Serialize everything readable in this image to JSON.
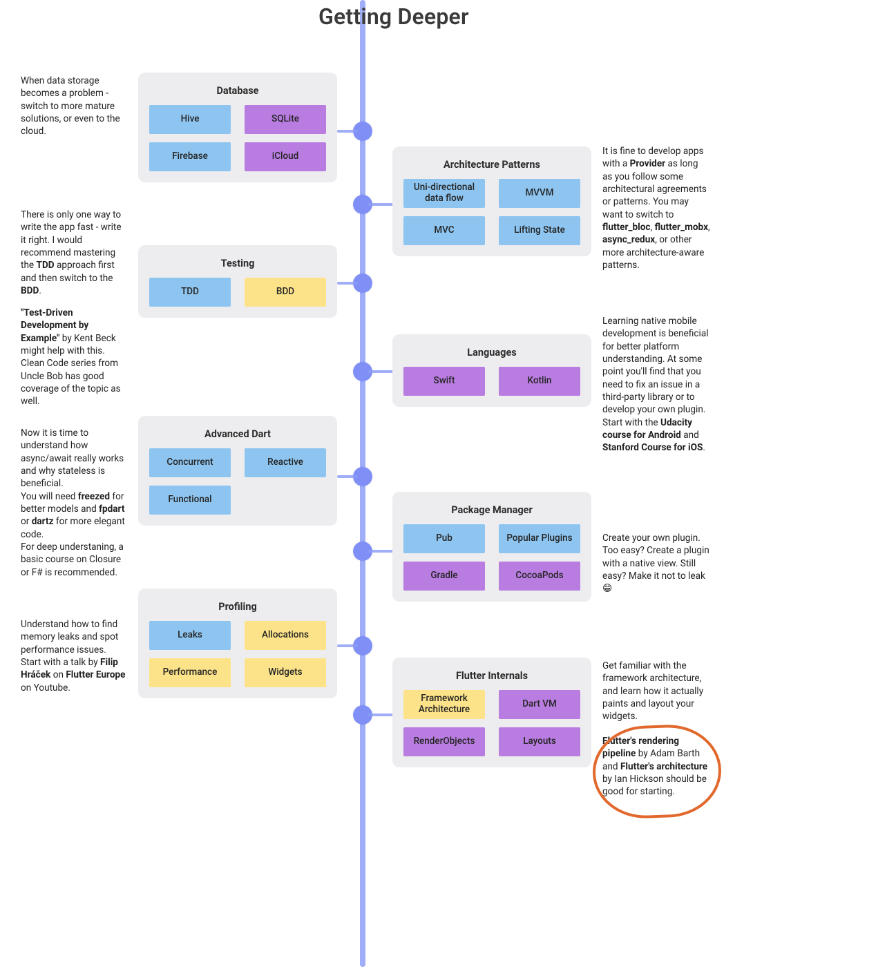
{
  "title": "Getting Deeper",
  "database": {
    "heading": "Database",
    "items": [
      {
        "label": "Hive",
        "c": "b"
      },
      {
        "label": "SQLite",
        "c": "p"
      },
      {
        "label": "Firebase",
        "c": "b"
      },
      {
        "label": "iCloud",
        "c": "p"
      }
    ]
  },
  "arch": {
    "heading": "Architecture Patterns",
    "items": [
      {
        "label": "Uni-directional data flow",
        "c": "b"
      },
      {
        "label": "MVVM",
        "c": "b"
      },
      {
        "label": "MVC",
        "c": "b"
      },
      {
        "label": "Lifting State",
        "c": "b"
      }
    ]
  },
  "testing": {
    "heading": "Testing",
    "items": [
      {
        "label": "TDD",
        "c": "b"
      },
      {
        "label": "BDD",
        "c": "y"
      }
    ]
  },
  "languages": {
    "heading": "Languages",
    "items": [
      {
        "label": "Swift",
        "c": "p"
      },
      {
        "label": "Kotlin",
        "c": "p"
      }
    ]
  },
  "advdart": {
    "heading": "Advanced Dart",
    "items": [
      {
        "label": "Concurrent",
        "c": "b"
      },
      {
        "label": "Reactive",
        "c": "b"
      },
      {
        "label": "Functional",
        "c": "b"
      }
    ]
  },
  "pkg": {
    "heading": "Package Manager",
    "items": [
      {
        "label": "Pub",
        "c": "b"
      },
      {
        "label": "Popular Plugins",
        "c": "b"
      },
      {
        "label": "Gradle",
        "c": "p"
      },
      {
        "label": "CocoaPods",
        "c": "p"
      }
    ]
  },
  "profiling": {
    "heading": "Profiling",
    "items": [
      {
        "label": "Leaks",
        "c": "b"
      },
      {
        "label": "Allocations",
        "c": "y"
      },
      {
        "label": "Performance",
        "c": "y"
      },
      {
        "label": "Widgets",
        "c": "y"
      }
    ]
  },
  "internals": {
    "heading": "Flutter Internals",
    "items": [
      {
        "label": "Framework Architecture",
        "c": "y"
      },
      {
        "label": "Dart VM",
        "c": "p"
      },
      {
        "label": "RenderObjects",
        "c": "p"
      },
      {
        "label": "Layouts",
        "c": "p"
      }
    ]
  },
  "notes": {
    "db": "When data storage becomes a problem - switch to more mature solutions, or even to the cloud.",
    "arch": "It is fine to develop apps with a <b>Provider</b> as long as you follow some architectural agreements or patterns. You may want to switch to <b>flutter_bloc</b>, <b>flutter_mobx</b>, <b>async_redux</b>, or other more architecture-aware patterns.",
    "testing1": "There is only one way to write the app fast - write it right. I would recommend mastering the <b>TDD</b> approach first and then switch to the <b>BDD</b>.",
    "testing2": "<b>\"Test-Driven Development by Example\"</b> by Kent Beck might help with this. Clean Code series from Uncle Bob has good coverage of the topic as well.",
    "lang": "Learning native mobile development is beneficial for better platform understanding. At some point you'll find that you need to fix an issue in a third-party library or to develop your own plugin. Start with the <b>Udacity course for Android</b> and <b>Stanford Course for iOS</b>.",
    "advdart": "Now it is time to understand how async/await really works and why stateless is beneficial.<br>You will need <b>freezed</b> for better models and <b>fpdart</b> or <b>dartz</b> for more elegant code.<br>For deep understaning, a basic course on Closure or F# is recommended.",
    "pkg": "Create your own plugin. Too easy? Create a plugin with a native view. Still easy? Make it not to leak 😁",
    "prof": "Understand how to find memory leaks and spot performance issues. Start with a talk by <b>Filip Hráček</b> on <b>Flutter Europe</b> on Youtube.",
    "int1": "Get familiar with the framework architecture, and learn how it actually paints and layout your widgets.",
    "int2": "<b>Flutter's rendering pipeline</b> by Adam Barth and <b>Flutter's architecture</b> by Ian Hickson should be good for starting."
  }
}
